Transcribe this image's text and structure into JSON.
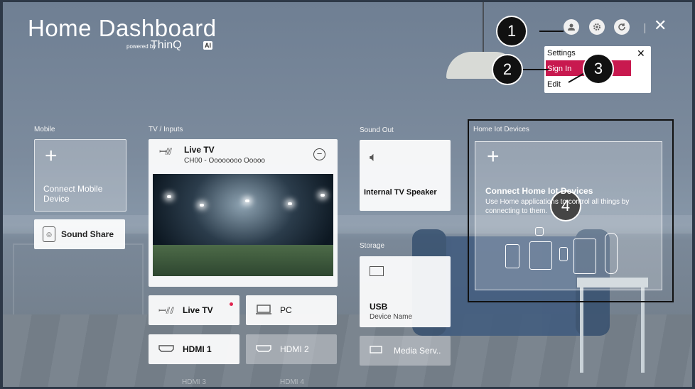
{
  "header": {
    "title": "Home Dashboard",
    "powered_by": "powered by",
    "brand": "ThinQ",
    "ai_badge": "AI"
  },
  "top_icons": [
    "account-icon",
    "settings-icon",
    "refresh-icon"
  ],
  "popup": {
    "settings_label": "Settings",
    "sign_in_label": "Sign In",
    "edit_label": "Edit"
  },
  "callouts": [
    "1",
    "2",
    "3",
    "4"
  ],
  "mobile": {
    "section_label": "Mobile",
    "connect_label": "Connect Mobile Device",
    "sound_share_label": "Sound Share"
  },
  "tv_inputs": {
    "section_label": "TV / Inputs",
    "live_tv_title": "Live TV",
    "channel": "CH00 - Oooooooo Ooooo",
    "inputs": [
      {
        "label": "Live TV",
        "icon": "antenna-icon"
      },
      {
        "label": "PC",
        "icon": "monitor-icon"
      },
      {
        "label": "HDMI 1",
        "icon": "hdmi-icon"
      },
      {
        "label": "HDMI 2",
        "icon": "hdmi-icon"
      }
    ],
    "faded_inputs": [
      "HDMI 3",
      "HDMI 4"
    ]
  },
  "sound_out": {
    "section_label": "Sound Out",
    "device_label": "Internal TV Speaker"
  },
  "storage": {
    "section_label": "Storage",
    "usb_label": "USB",
    "usb_device": "Device Name",
    "media_label": "Media Serv.."
  },
  "iot": {
    "section_label": "Home Iot Devices",
    "title": "Connect Home Iot Devices",
    "desc": "Use Home applications to control all things by connecting to them."
  }
}
